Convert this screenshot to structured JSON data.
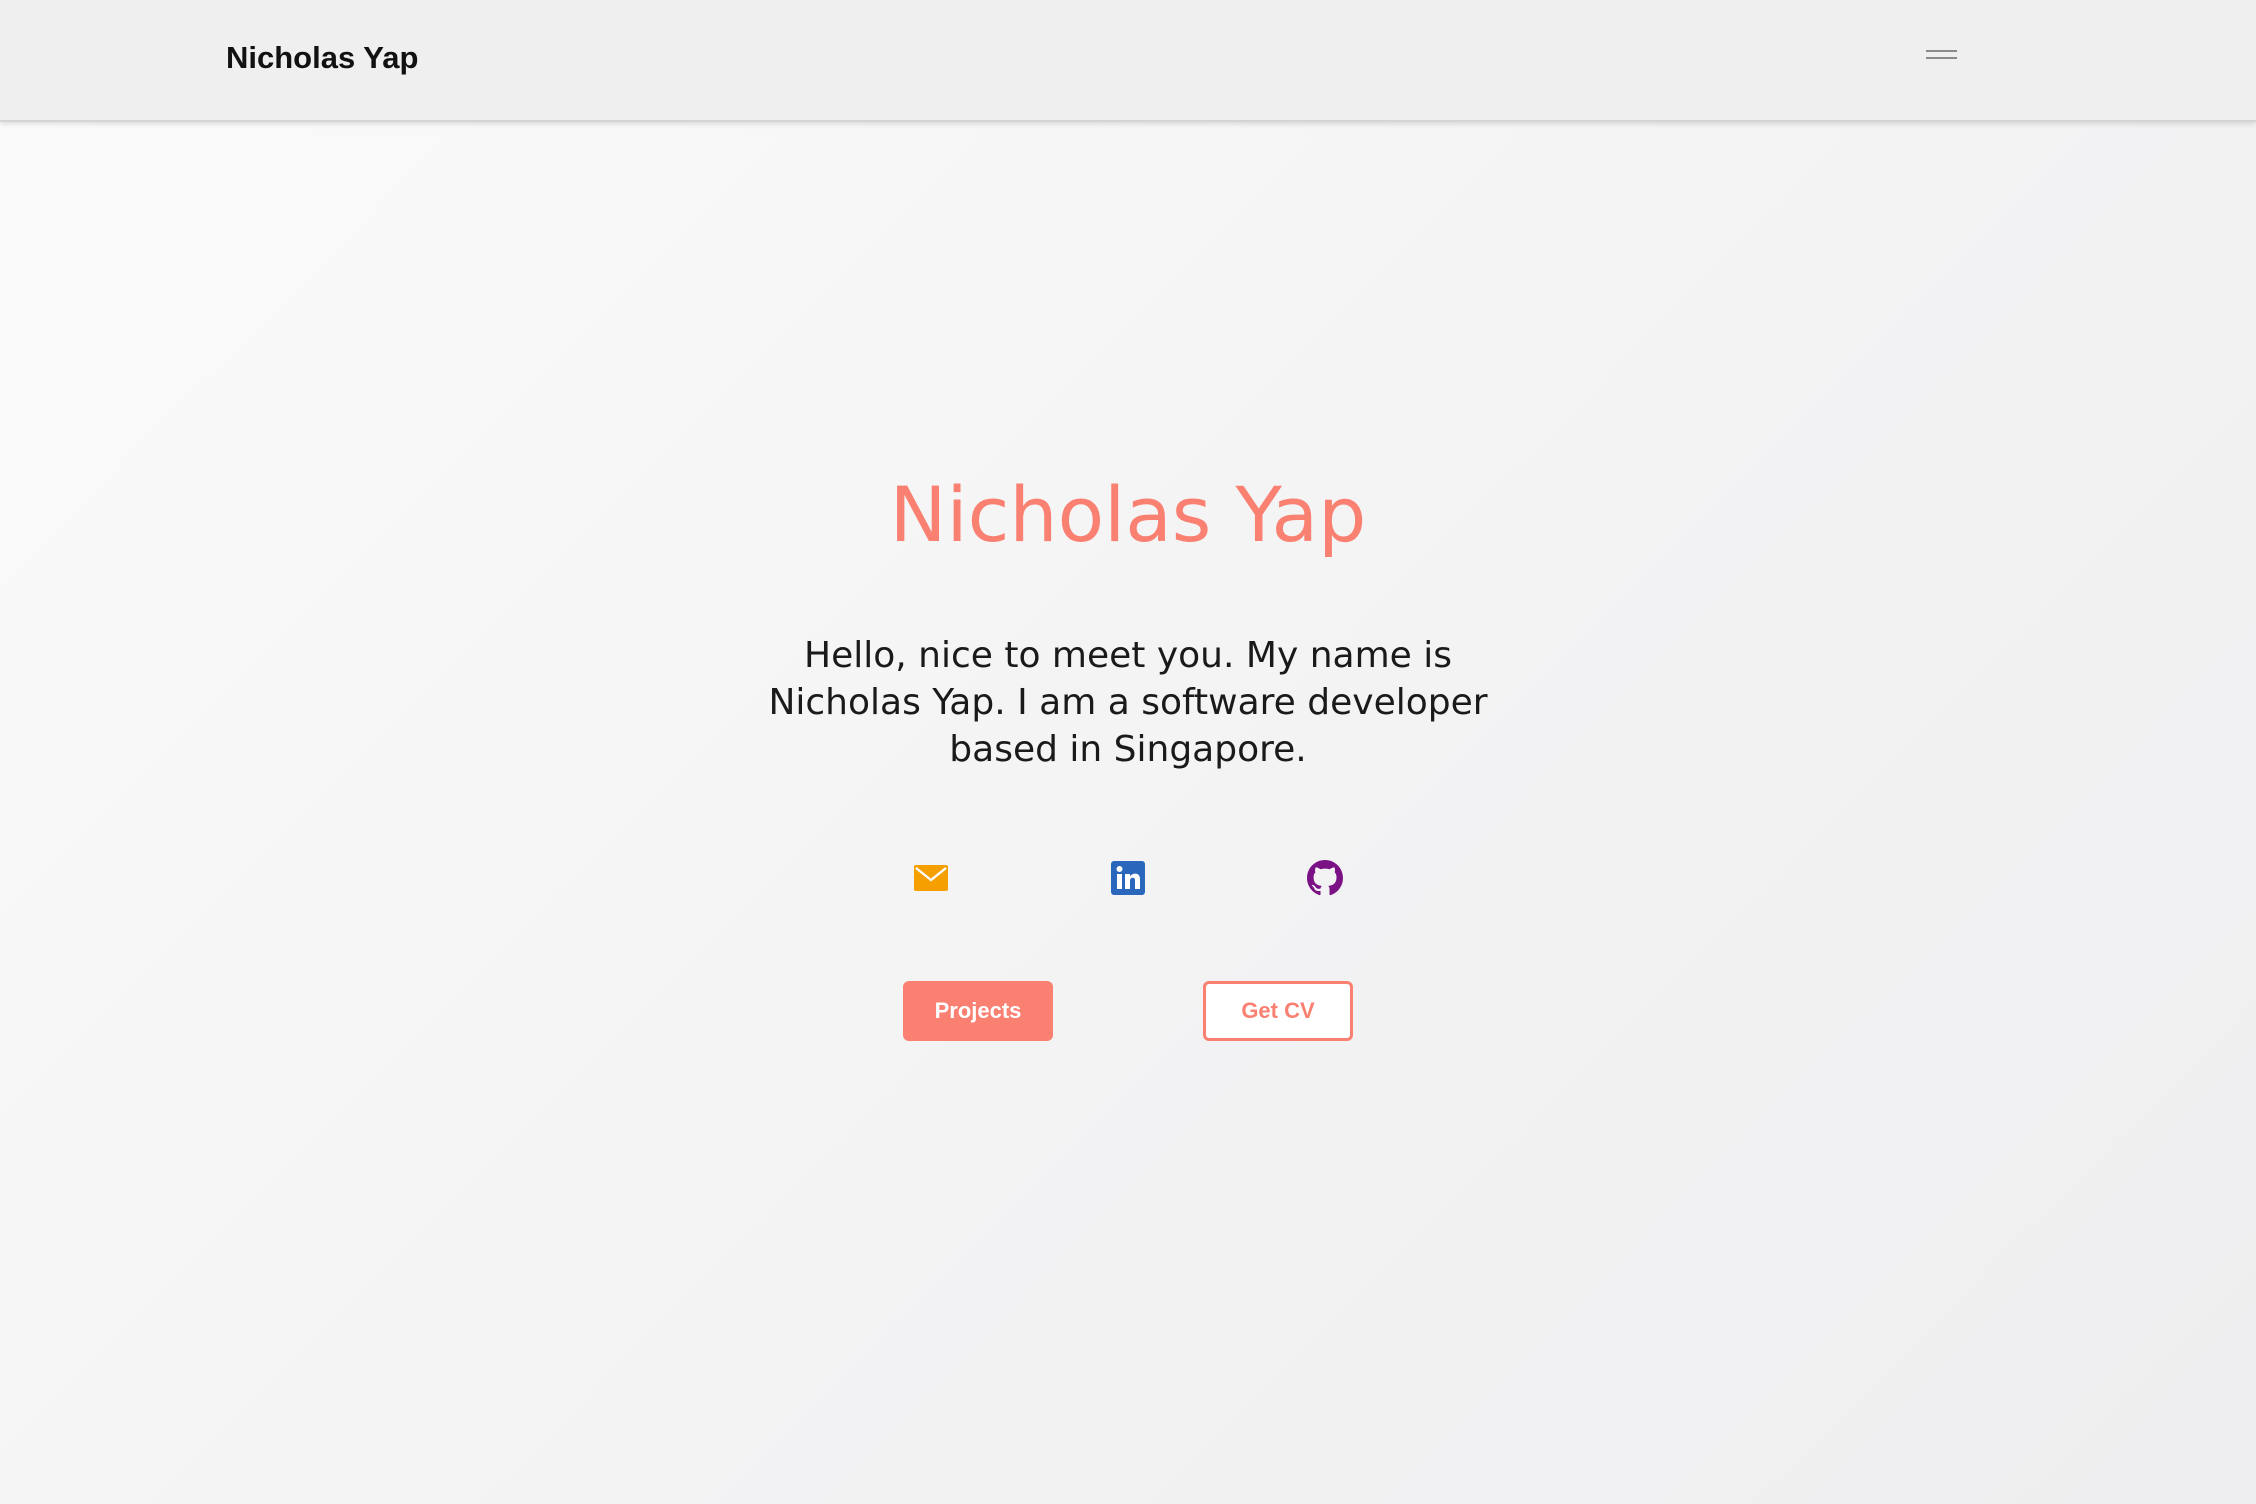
{
  "navbar": {
    "brand": "Nicholas Yap",
    "menu_icon": "hamburger-menu-icon"
  },
  "hero": {
    "title": "Nicholas Yap",
    "intro": "Hello, nice to meet you. My name is Nicholas Yap. I am a software developer based in Singapore."
  },
  "socials": [
    {
      "icon": "mail-icon",
      "color": "#f5a000"
    },
    {
      "icon": "linkedin-icon",
      "color": "#2a66bc"
    },
    {
      "icon": "github-icon",
      "color": "#7a1185"
    }
  ],
  "buttons": {
    "projects": "Projects",
    "cv": "Get CV"
  },
  "colors": {
    "accent": "#fa8072",
    "navbar_bg": "#efefef"
  }
}
